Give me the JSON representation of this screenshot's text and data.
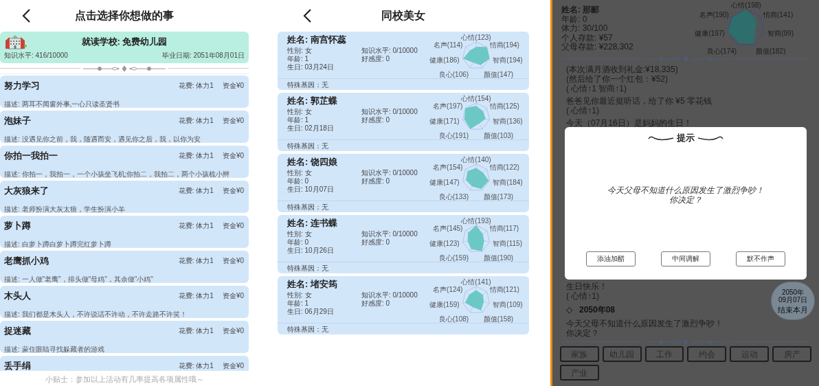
{
  "activities_screen": {
    "title": "点击选择你想做的事",
    "school": {
      "title": "就读学校: 免费幼儿园",
      "knowledge": "知识水平: 416/10000",
      "graduation": "毕业日期: 2051年08月01日"
    },
    "activities": [
      {
        "title": "努力学习",
        "cost": "花费: 体力1",
        "money": "资金¥0",
        "description": "描述: 两耳不闻窗外事,一心只读圣贤书"
      },
      {
        "title": "泡妹子",
        "cost": "花费: 体力1",
        "money": "资金¥0",
        "description": "描述: 没遇见你之前，我，随遇而安，遇见你之后，我，以你为安"
      },
      {
        "title": "你拍一我拍一",
        "cost": "花费: 体力1",
        "money": "资金¥0",
        "description": "描述: 你拍一，我拍一，一个小孩坐飞机;你拍二，我拍二，两个小孩梳小辫"
      },
      {
        "title": "大灰狼来了",
        "cost": "花费: 体力1",
        "money": "资金¥0",
        "description": "描述: 老师扮演大灰太狼，学生扮演小羊"
      },
      {
        "title": "萝卜蹲",
        "cost": "花费: 体力1",
        "money": "资金¥0",
        "description": "描述: 白萝卜蹲白萝卜蹲完红萝卜蹲"
      },
      {
        "title": "老鹰抓小鸡",
        "cost": "花费: 体力1",
        "money": "资金¥0",
        "description": "描述: 一人做\"老鹰\"，排头做\"母鸡\"，其余做\"小鸡\""
      },
      {
        "title": "木头人",
        "cost": "花费: 体力1",
        "money": "资金¥0",
        "description": "描述: 我们都是木头人，不许说话不许动，不许走路不许笑！"
      },
      {
        "title": "捉迷藏",
        "cost": "花费: 体力1",
        "money": "资金¥0",
        "description": "描述: 蒙住眼睛寻找躲藏者的游戏"
      },
      {
        "title": "丢手绢",
        "cost": "花费: 体力1",
        "money": "资金¥0"
      }
    ],
    "tip": "小贴士：参加以上活动有几率提高各项属性哦～"
  },
  "classmates_screen": {
    "title": "同校美女",
    "girls": [
      {
        "name": "姓名: 南宫怀蕊",
        "gender": "性别: 女",
        "age": "年龄: 1",
        "birthday": "生日: 03月24日",
        "knowledge": "知识水平: 0/10000",
        "affection": "好感度: 0",
        "gene": "特殊基因：无",
        "stats": [
          "心情(123)",
          "名声(114)",
          "情商(194)",
          "健康(186)",
          "智商(194)",
          "良心(106)",
          "颜值(147)"
        ]
      },
      {
        "name": "姓名: 郭芷蝶",
        "gender": "性别: 女",
        "age": "年龄: 1",
        "birthday": "生日: 02月18日",
        "knowledge": "知识水平: 0/10000",
        "affection": "好感度: 0",
        "gene": "特殊基因：无",
        "stats": [
          "心情(154)",
          "名声(197)",
          "情商(125)",
          "健康(171)",
          "智商(136)",
          "良心(191)",
          "颜值(103)"
        ]
      },
      {
        "name": "姓名: 饶四娘",
        "gender": "性别: 女",
        "age": "年龄: 0",
        "birthday": "生日: 10月07日",
        "knowledge": "知识水平: 0/10000",
        "affection": "好感度: 0",
        "gene": "特殊基因：无",
        "stats": [
          "心情(140)",
          "名声(154)",
          "情商(122)",
          "健康(147)",
          "智商(184)",
          "良心(133)",
          "颜值(173)"
        ]
      },
      {
        "name": "姓名: 连书蝶",
        "gender": "性别: 女",
        "age": "年龄: 0",
        "birthday": "生日: 10月26日",
        "knowledge": "知识水平: 0/10000",
        "affection": "好感度: 0",
        "gene": "特殊基因：无",
        "stats": [
          "心情(193)",
          "名声(145)",
          "情商(117)",
          "健康(123)",
          "智商(115)",
          "良心(159)",
          "颜值(190)"
        ]
      },
      {
        "name": "姓名: 堵安筠",
        "gender": "性别: 女",
        "age": "年龄: 1",
        "birthday": "生日: 06月29日",
        "knowledge": "知识水平: 0/10000",
        "affection": "好感度: 0",
        "gene": "特殊基因：无",
        "stats": [
          "心情(141)",
          "名声(124)",
          "情商(121)",
          "健康(159)",
          "智商(109)",
          "良心(108)",
          "颜值(158)"
        ]
      }
    ]
  },
  "life_screen": {
    "name": "姓名: 那郦",
    "info": [
      "年龄: 0",
      "体力: 30/100",
      "个人存款: ¥57",
      "父母存款: ¥228,302"
    ],
    "stats": [
      "心情(198)",
      "名声(190)",
      "情商(141)",
      "健康(197)",
      "智商(99)",
      "良心(174)",
      "颜值(182)"
    ],
    "log_above": [
      {
        "kind": "text",
        "lines": [
          "(本次满月酒收到礼金:¥18,335)",
          "(然后给了你一个红包：¥52)",
          "( 心情↑1 智商↑1)"
        ]
      },
      {
        "kind": "text",
        "lines": [
          "爸爸见你最近挺听话，给了你 ¥5 零花钱",
          "( 心情↑1)"
        ]
      },
      {
        "kind": "text",
        "lines": [
          "今天（07月16日）是妈妈的生日！"
        ]
      }
    ],
    "dialog": {
      "title": "提示",
      "message": [
        "今天父母不知道什么原因发生了激烈争吵！",
        "你决定？"
      ],
      "buttons": [
        "添油加醋",
        "中间调解",
        "默不作声"
      ]
    },
    "log_below": [
      {
        "kind": "text",
        "lines": [
          "生日快乐！",
          "( 心情↑1)"
        ]
      },
      {
        "kind": "heading",
        "lines": [
          "◇",
          "2050年08"
        ]
      },
      {
        "kind": "text",
        "lines": [
          "今天父母不知道什么原因发生了激烈争吵！",
          "你决定？"
        ]
      }
    ],
    "end_month": {
      "year": "2050年",
      "date": "09月07日",
      "label": "结束本月"
    },
    "tabs": [
      "家族",
      "幼儿园",
      "工作",
      "约会",
      "运动",
      "房产",
      "产业"
    ]
  }
}
